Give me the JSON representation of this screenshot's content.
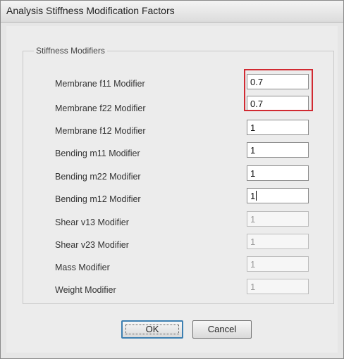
{
  "window": {
    "title": "Analysis Stiffness Modification Factors"
  },
  "group": {
    "legend": "Stiffness Modifiers"
  },
  "rows": [
    {
      "label": "Membrane f11 Modifier",
      "value": "0.7"
    },
    {
      "label": "Membrane f22 Modifier",
      "value": "0.7"
    },
    {
      "label": "Membrane f12 Modifier",
      "value": "1"
    },
    {
      "label": "Bending m11 Modifier",
      "value": "1"
    },
    {
      "label": "Bending m22 Modifier",
      "value": "1"
    },
    {
      "label": "Bending m12 Modifier",
      "value": "1"
    },
    {
      "label": "Shear v13 Modifier",
      "value": "1"
    },
    {
      "label": "Shear v23 Modifier",
      "value": "1"
    },
    {
      "label": "Mass Modifier",
      "value": "1"
    },
    {
      "label": "Weight Modifier",
      "value": "1"
    }
  ],
  "buttons": {
    "ok": "OK",
    "cancel": "Cancel"
  },
  "colors": {
    "highlight": "#d12a32",
    "focus_border": "#3c7fb1"
  }
}
